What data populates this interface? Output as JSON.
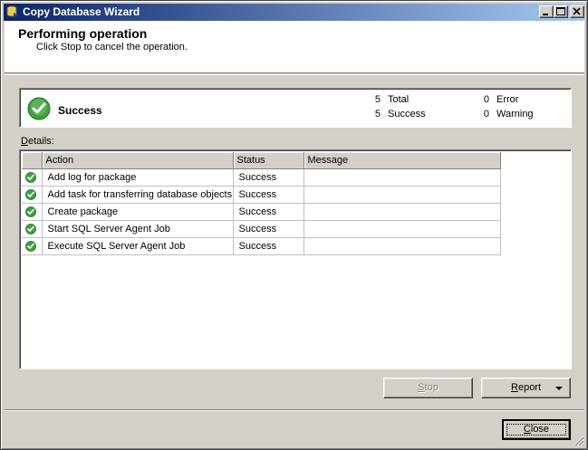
{
  "window": {
    "title": "Copy Database Wizard"
  },
  "header": {
    "title": "Performing operation",
    "subtitle": "Click Stop to cancel the operation."
  },
  "summary": {
    "status": "Success",
    "total_count": "5",
    "total_label": "Total",
    "success_count": "5",
    "success_label": "Success",
    "error_count": "0",
    "error_label": "Error",
    "warning_count": "0",
    "warning_label": "Warning"
  },
  "details": {
    "label_prefix": "D",
    "label_rest": "etails:",
    "columns": {
      "action": "Action",
      "status": "Status",
      "message": "Message"
    },
    "rows": [
      {
        "icon": "success-icon",
        "action": "Add log for package",
        "status": "Success",
        "message": ""
      },
      {
        "icon": "success-icon",
        "action": "Add task for transferring database objects",
        "status": "Success",
        "message": ""
      },
      {
        "icon": "success-icon",
        "action": "Create package",
        "status": "Success",
        "message": ""
      },
      {
        "icon": "success-icon",
        "action": "Start SQL Server Agent Job",
        "status": "Success",
        "message": ""
      },
      {
        "icon": "success-icon",
        "action": "Execute SQL Server Agent Job",
        "status": "Success",
        "message": ""
      }
    ]
  },
  "buttons": {
    "stop_accel": "S",
    "stop_rest": "top",
    "report_accel": "R",
    "report_rest": "eport",
    "close_accel": "C",
    "close_rest": "lose"
  },
  "colors": {
    "title_start": "#0a246a",
    "title_end": "#a6caf0",
    "success_green": "#3ea33e"
  }
}
